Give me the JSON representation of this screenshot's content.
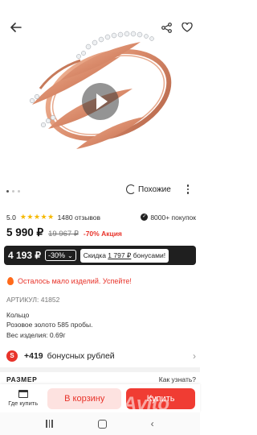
{
  "product": {
    "rating": "5.0",
    "stars": "★★★★★",
    "reviews": "1480 отзывов",
    "buyers": "8000+ покупок",
    "price": "5 990 ₽",
    "old_price": "19 967 ₽",
    "discount": "-70% Акция"
  },
  "actions": {
    "similar_label": "Похожие"
  },
  "bonus_offer": {
    "price": "4 193 ₽",
    "percent": "-30%",
    "promo_prefix": "Скидка ",
    "promo_amount": "1 797 ₽",
    "promo_suffix": " бонусами!"
  },
  "stock_notice": "Осталось мало изделий. Успейте!",
  "details": {
    "article": "АРТИКУЛ: 41852",
    "type": "Кольцо",
    "material": "Розовое золото 585 пробы.",
    "weight": "Вес изделия: 0.69г"
  },
  "bonus": {
    "badge": "S",
    "amount": "+419",
    "label": "бонусных рублей"
  },
  "size": {
    "title": "РАЗМЕР",
    "link": "Как узнать?"
  },
  "bottom_bar": {
    "where_buy": "Где купить",
    "cart": "В корзину",
    "buy": "Купить"
  },
  "watermark": "Avito",
  "icons": {
    "back": "arrow-left-icon",
    "share": "share-icon",
    "favorite": "heart-icon",
    "play": "play-icon",
    "similar": "similar-icon",
    "more": "more-vertical-icon",
    "fire": "fire-icon",
    "store": "store-icon"
  },
  "colors": {
    "accent": "#f03c33",
    "accent_light": "#fde2e0",
    "dark_bar": "#1f1f1f",
    "star": "#f5b800",
    "ring_gold": "#d98a6a"
  }
}
